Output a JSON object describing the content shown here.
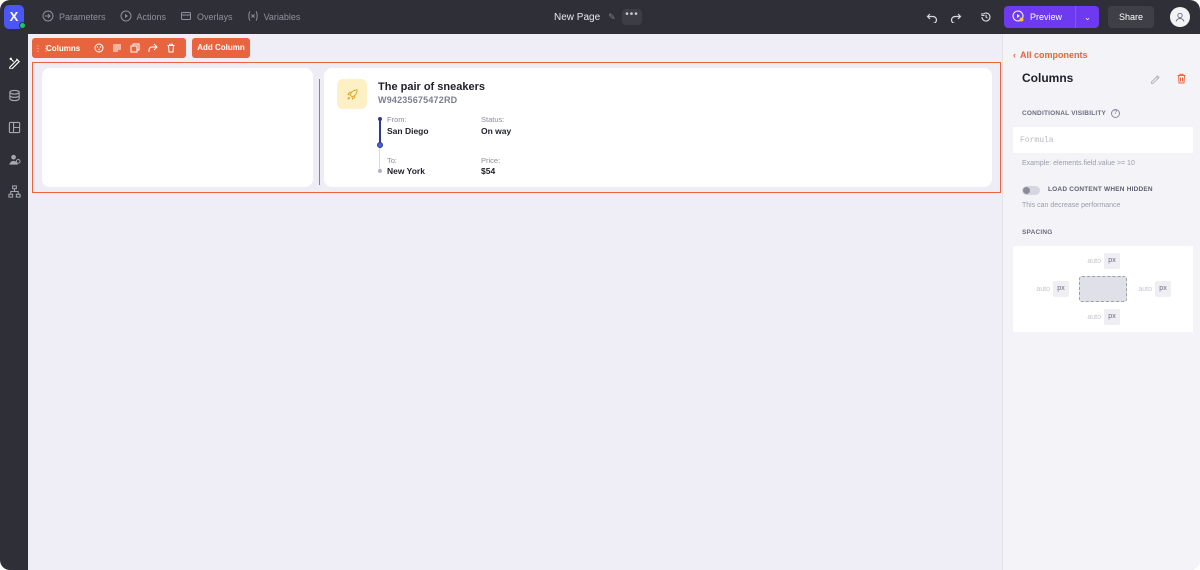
{
  "app": {
    "logo_letter": "X",
    "nav": [
      {
        "label": "Parameters",
        "icon": "parameters-icon"
      },
      {
        "label": "Actions",
        "icon": "play-circle-icon"
      },
      {
        "label": "Overlays",
        "icon": "overlays-icon"
      },
      {
        "label": "Variables",
        "icon": "variables-icon"
      }
    ],
    "page_title": "New Page",
    "more_label": "•••",
    "preview_label": "Preview",
    "share_label": "Share"
  },
  "sidebar": {
    "items": [
      {
        "icon": "design-tools-icon",
        "active": true
      },
      {
        "icon": "database-icon",
        "active": false
      },
      {
        "icon": "layout-icon",
        "active": false
      },
      {
        "icon": "users-icon",
        "active": false
      },
      {
        "icon": "hierarchy-icon",
        "active": false
      }
    ]
  },
  "canvas": {
    "toolbar_label": "Columns",
    "add_column_label": "Add Column",
    "shipment": {
      "title": "The pair of sneakers",
      "code": "W94235675472RD",
      "from_label": "From:",
      "from_value": "San Diego",
      "to_label": "To:",
      "to_value": "New York",
      "status_label": "Status:",
      "status_value": "On way",
      "price_label": "Price:",
      "price_value": "$54"
    }
  },
  "panel": {
    "back_label": "All components",
    "title": "Columns",
    "conditional_visibility_label": "CONDITIONAL VISIBILITY",
    "formula_placeholder": "Formula",
    "formula_hint": "Example: elements.field.value >= 10",
    "load_hidden_label": "LOAD CONTENT WHEN HIDDEN",
    "load_hidden_hint": "This can decrease performance",
    "spacing_label": "SPACING",
    "spacing": {
      "top": {
        "value": "auto",
        "unit": "px"
      },
      "left": {
        "value": "auto",
        "unit": "px"
      },
      "right": {
        "value": "auto",
        "unit": "px"
      },
      "bottom": {
        "value": "auto",
        "unit": "px"
      }
    }
  },
  "colors": {
    "accent": "#e8643f",
    "preview": "#6d3af0",
    "topbar": "#2f3037",
    "timeline": "#2e3a8c"
  }
}
